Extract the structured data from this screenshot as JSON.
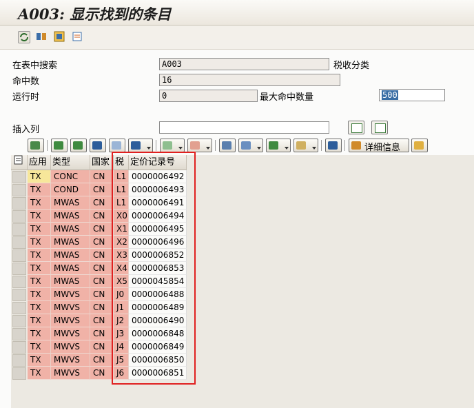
{
  "window": {
    "title": "A003: 显示找到的条目"
  },
  "form": {
    "search_in_table_label": "在表中搜索",
    "search_in_table_value": "A003",
    "search_in_table_desc": "税收分类",
    "hits_label": "命中数",
    "hits_value": "16",
    "runtime_label": "运行时",
    "runtime_value": "0",
    "max_hits_label": "最大命中数量",
    "max_hits_value": "500",
    "insert_column_label": "插入列",
    "insert_column_value": ""
  },
  "toolbar": {
    "detail_label": "详细信息"
  },
  "table": {
    "headers": [
      "应用",
      "类型",
      "国家",
      "税",
      "定价记录号"
    ],
    "rows": [
      [
        "TX",
        "CONC",
        "CN",
        "L1",
        "0000006492"
      ],
      [
        "TX",
        "COND",
        "CN",
        "L1",
        "0000006493"
      ],
      [
        "TX",
        "MWAS",
        "CN",
        "L1",
        "0000006491"
      ],
      [
        "TX",
        "MWAS",
        "CN",
        "X0",
        "0000006494"
      ],
      [
        "TX",
        "MWAS",
        "CN",
        "X1",
        "0000006495"
      ],
      [
        "TX",
        "MWAS",
        "CN",
        "X2",
        "0000006496"
      ],
      [
        "TX",
        "MWAS",
        "CN",
        "X3",
        "0000006852"
      ],
      [
        "TX",
        "MWAS",
        "CN",
        "X4",
        "0000006853"
      ],
      [
        "TX",
        "MWAS",
        "CN",
        "X5",
        "0000045854"
      ],
      [
        "TX",
        "MWVS",
        "CN",
        "J0",
        "0000006488"
      ],
      [
        "TX",
        "MWVS",
        "CN",
        "J1",
        "0000006489"
      ],
      [
        "TX",
        "MWVS",
        "CN",
        "J2",
        "0000006490"
      ],
      [
        "TX",
        "MWVS",
        "CN",
        "J3",
        "0000006848"
      ],
      [
        "TX",
        "MWVS",
        "CN",
        "J4",
        "0000006849"
      ],
      [
        "TX",
        "MWVS",
        "CN",
        "J5",
        "0000006850"
      ],
      [
        "TX",
        "MWVS",
        "CN",
        "J6",
        "0000006851"
      ]
    ]
  },
  "colors": {
    "key_cell": "#f0b2a7",
    "key_cell_current": "#f7e79a",
    "highlight_box": "#e02020"
  }
}
